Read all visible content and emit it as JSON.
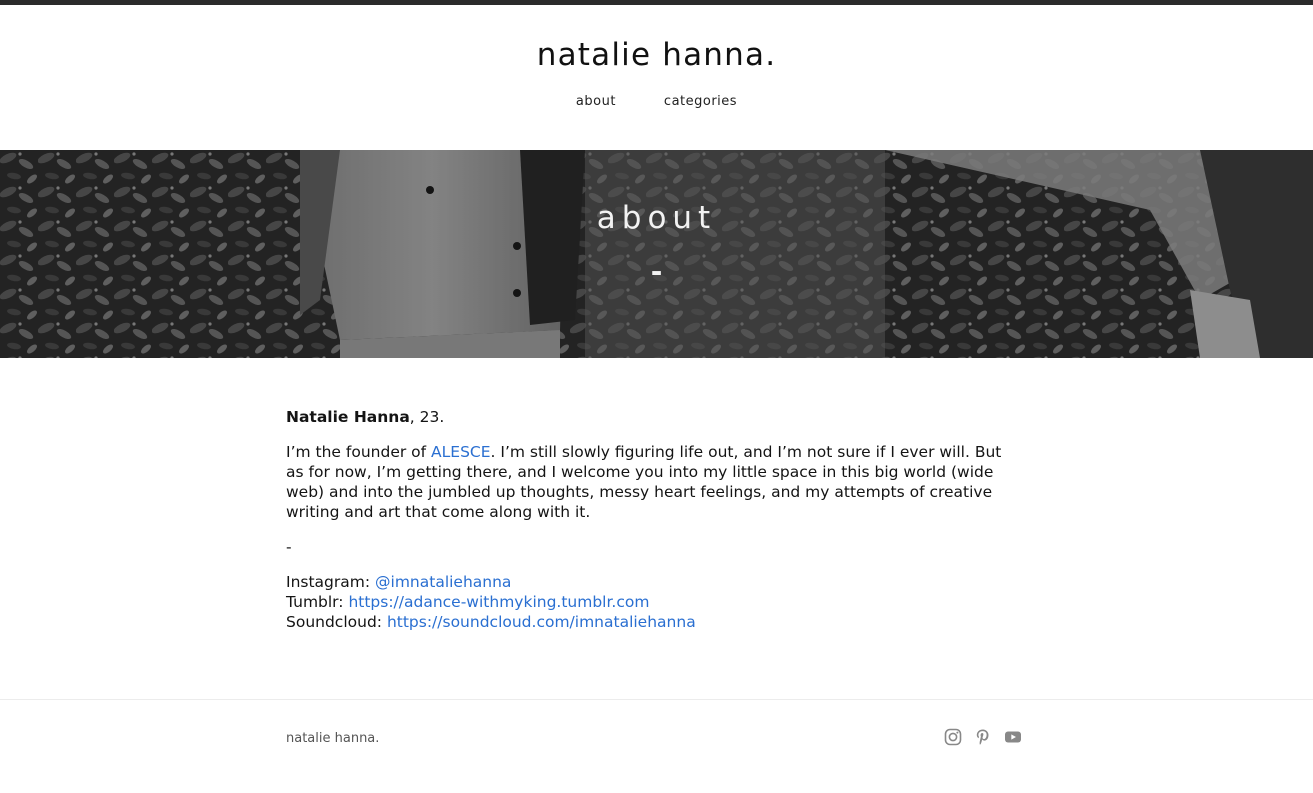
{
  "site": {
    "title": "natalie hanna."
  },
  "nav": {
    "items": [
      {
        "label": "about"
      },
      {
        "label": "categories"
      }
    ]
  },
  "hero": {
    "title": "about",
    "dash": "-"
  },
  "content": {
    "name": "Natalie Hanna",
    "age_suffix": ", 23.",
    "bio_before_link": "I’m the founder of ",
    "bio_link": "ALESCE",
    "bio_after_link": ". I’m still slowly figuring life out, and I’m not sure if I ever will. But as for now, I’m getting there, and I welcome you into my little space in this big world (wide web) and into the jumbled up thoughts, messy heart feelings, and my attempts of creative writing and art that come along with it.",
    "separator": "-",
    "links": [
      {
        "label": "Instagram: ",
        "value": "@imnataliehanna"
      },
      {
        "label": "Tumblr: ",
        "value": "https://adance-withmyking.tumblr.com"
      },
      {
        "label": "Soundcloud: ",
        "value": "https://soundcloud.com/imnataliehanna"
      }
    ]
  },
  "footer": {
    "brand": "natalie hanna.",
    "social_icons": [
      "instagram-icon",
      "pinterest-icon",
      "youtube-icon"
    ],
    "icon_color": "#888888"
  },
  "colors": {
    "link": "#2a6fd1",
    "text": "#141414",
    "topbar": "#2b2b2b"
  }
}
